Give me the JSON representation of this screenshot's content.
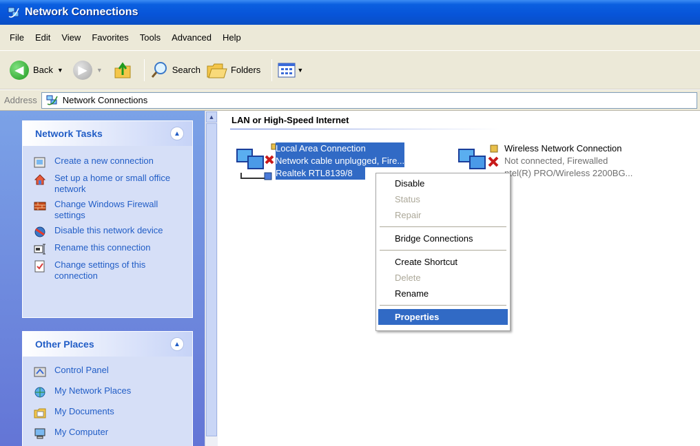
{
  "window": {
    "title": "Network Connections"
  },
  "menu": [
    "File",
    "Edit",
    "View",
    "Favorites",
    "Tools",
    "Advanced",
    "Help"
  ],
  "toolbar": {
    "back_label": "Back",
    "search_label": "Search",
    "folders_label": "Folders"
  },
  "address": {
    "label": "Address",
    "value": "Network Connections"
  },
  "network_tasks": {
    "title": "Network Tasks",
    "items": [
      {
        "label": "Create a new connection",
        "icon": "new-connection-icon"
      },
      {
        "label": "Set up a home or small office network",
        "icon": "home-network-icon"
      },
      {
        "label": "Change Windows Firewall settings",
        "icon": "firewall-icon"
      },
      {
        "label": "Disable this network device",
        "icon": "disable-device-icon"
      },
      {
        "label": "Rename this connection",
        "icon": "rename-icon"
      },
      {
        "label": "Change settings of this connection",
        "icon": "settings-icon"
      }
    ]
  },
  "other_places": {
    "title": "Other Places",
    "items": [
      {
        "label": "Control Panel",
        "icon": "control-panel-icon"
      },
      {
        "label": "My Network Places",
        "icon": "network-places-icon"
      },
      {
        "label": "My Documents",
        "icon": "documents-icon"
      },
      {
        "label": "My Computer",
        "icon": "computer-icon"
      }
    ]
  },
  "group": {
    "title": "LAN or High-Speed Internet"
  },
  "connections": [
    {
      "name": "Local Area Connection",
      "status": "Network cable unplugged, Fire...",
      "device": "Realtek RTL8139/8",
      "selected": true
    },
    {
      "name": "Wireless Network Connection",
      "status": "Not connected, Firewalled",
      "device": "ntel(R) PRO/Wireless 2200BG...",
      "selected": false
    }
  ],
  "context_menu": {
    "disable": "Disable",
    "status": "Status",
    "repair": "Repair",
    "bridge": "Bridge Connections",
    "shortcut": "Create Shortcut",
    "delete": "Delete",
    "rename": "Rename",
    "properties": "Properties"
  },
  "colors": {
    "title_blue": "#0754d8",
    "selection": "#316ac5",
    "task_link": "#215dc6",
    "sidebar": "#6375d6"
  }
}
